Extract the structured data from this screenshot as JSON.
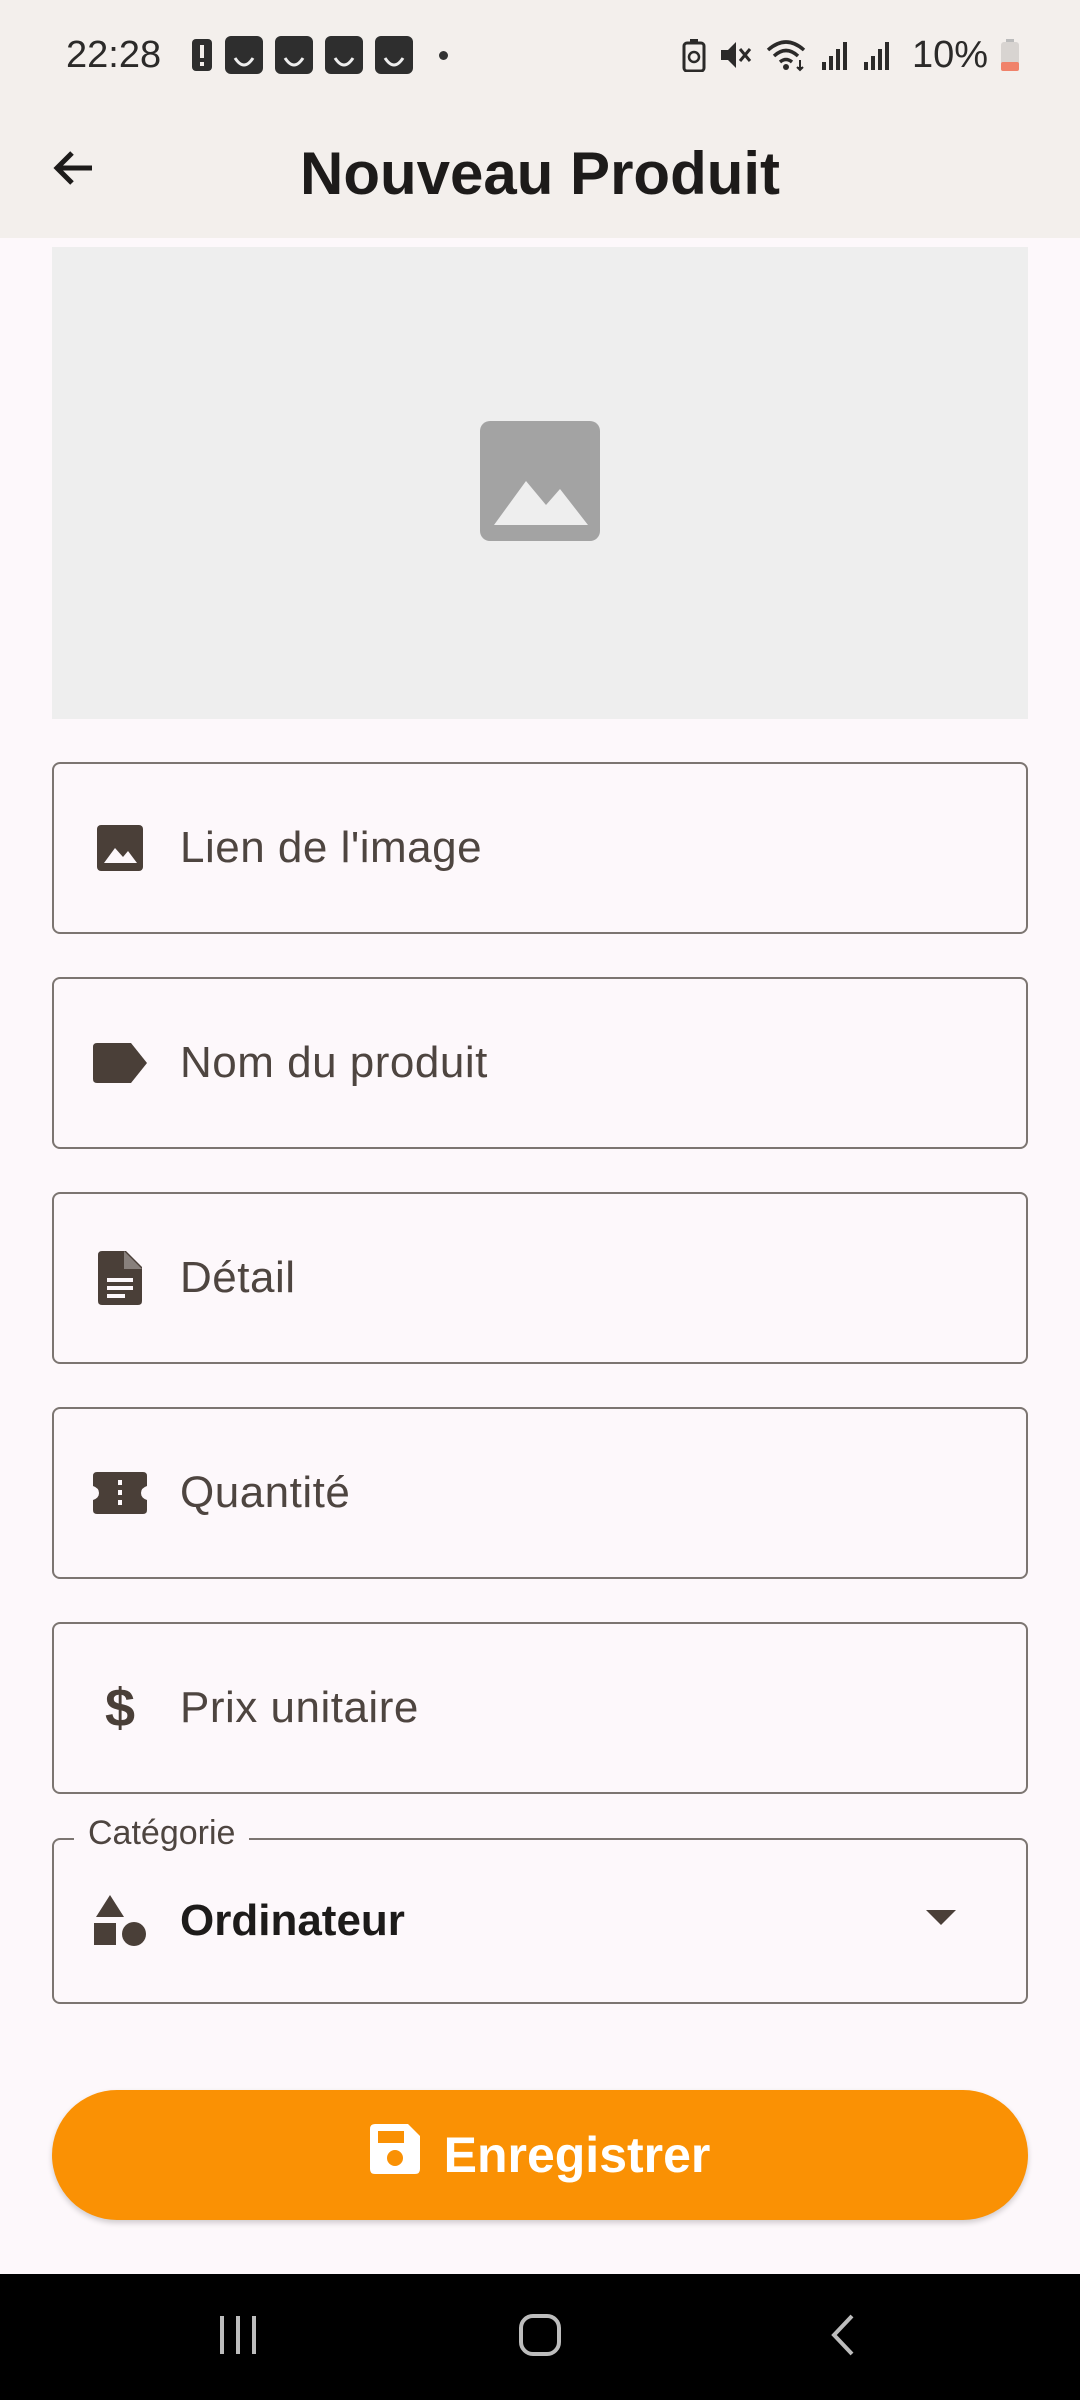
{
  "status_bar": {
    "time": "22:28",
    "battery": "10%",
    "icons": [
      "alert-icon",
      "app-notification-icon",
      "app-notification-icon",
      "app-notification-icon",
      "app-notification-icon",
      "dot-icon",
      "battery-saver-icon",
      "mute-icon",
      "wifi-icon",
      "signal-icon",
      "signal-icon",
      "battery-icon"
    ]
  },
  "app_bar": {
    "title": "Nouveau Produit",
    "back_icon": "arrow-back-icon"
  },
  "image_preview": {
    "icon": "image-placeholder-icon"
  },
  "form": {
    "image_link": {
      "label": "Lien de l'image",
      "icon": "image-icon"
    },
    "product_name": {
      "label": "Nom du produit",
      "icon": "label-tag-icon"
    },
    "detail": {
      "label": "Détail",
      "icon": "description-icon"
    },
    "quantity": {
      "label": "Quantité",
      "icon": "ticket-icon"
    },
    "unit_price": {
      "label": "Prix unitaire",
      "icon": "dollar-icon"
    },
    "category": {
      "label": "Catégorie",
      "value": "Ordinateur",
      "icon": "category-shapes-icon"
    }
  },
  "save_button": {
    "label": "Enregistrer",
    "icon": "save-icon"
  },
  "colors": {
    "accent": "#fa9104",
    "bar_background": "#f3efec",
    "page_background": "#fdf8fb",
    "field_border": "#7c7571",
    "icon_color": "#4a3f38"
  },
  "nav_bar": {
    "buttons": [
      "recents-icon",
      "home-icon",
      "back-icon"
    ]
  }
}
